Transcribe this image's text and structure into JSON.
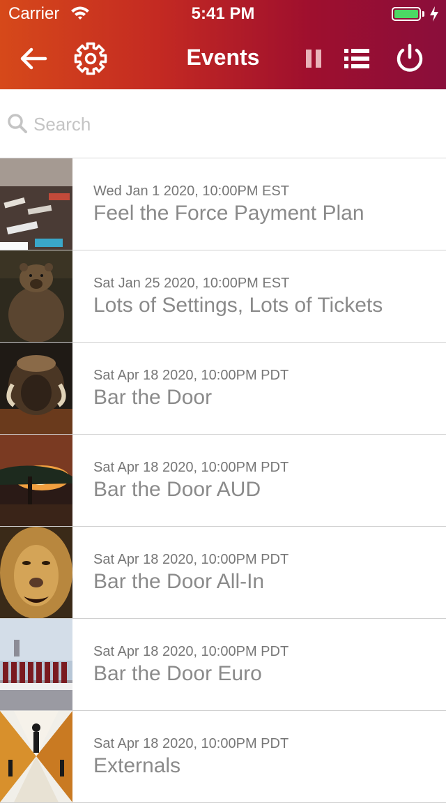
{
  "status_bar": {
    "carrier": "Carrier",
    "time": "5:41 PM",
    "battery_level": 1.0
  },
  "nav": {
    "title": "Events",
    "icons": [
      "arrow-left-icon",
      "gear-icon",
      "pause-icon",
      "list-icon",
      "power-icon"
    ]
  },
  "search": {
    "placeholder": "Search",
    "value": ""
  },
  "colors": {
    "header_start": "#d6491a",
    "header_end": "#8a0e3b",
    "battery": "#4cd964"
  },
  "events": [
    {
      "date": "Wed Jan 1 2020, 10:00PM EST",
      "title": "Feel the Force Payment Plan"
    },
    {
      "date": "Sat Jan 25 2020, 10:00PM EST",
      "title": "Lots of Settings, Lots of Tickets"
    },
    {
      "date": "Sat Apr 18 2020, 10:00PM PDT",
      "title": "Bar the Door"
    },
    {
      "date": "Sat Apr 18 2020, 10:00PM PDT",
      "title": "Bar the Door AUD"
    },
    {
      "date": "Sat Apr 18 2020, 10:00PM PDT",
      "title": "Bar the Door All-In"
    },
    {
      "date": "Sat Apr 18 2020, 10:00PM PDT",
      "title": "Bar the Door Euro"
    },
    {
      "date": "Sat Apr 18 2020, 10:00PM PDT",
      "title": "Externals"
    }
  ]
}
